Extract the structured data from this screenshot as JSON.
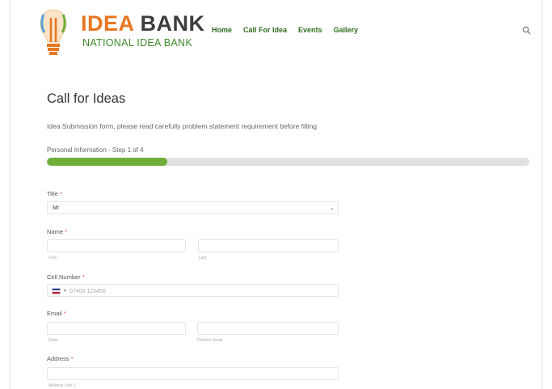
{
  "brand": {
    "title_left": "IDEA",
    "title_right": "BANK",
    "subtitle": "NATIONAL IDEA BANK",
    "accent": "#e87722",
    "green": "#3f8a2a"
  },
  "nav": {
    "items": [
      "Home",
      "Call For Idea",
      "Events",
      "Gallery"
    ]
  },
  "header": {
    "search_icon": "search-icon"
  },
  "page": {
    "title": "Call for Ideas",
    "intro": "Idea Submission form, please read carefully problem statement requirement before filling",
    "step_label": "Personal Information - Step 1 of 4",
    "progress": 0.25
  },
  "form": {
    "title": {
      "label": "Title",
      "required": "*",
      "value": "Mr"
    },
    "name": {
      "label": "Name",
      "required": "*",
      "first_sub": "First",
      "last_sub": "Last"
    },
    "cell": {
      "label": "Cell Number",
      "required": "*",
      "placeholder": "07400 123456"
    },
    "email": {
      "label": "Email",
      "required": "*",
      "email_sub": "Enter",
      "confirm_sub": "Confirm Email"
    },
    "address": {
      "label": "Address",
      "required": "*",
      "line1_sub": "Address Line 1"
    }
  }
}
